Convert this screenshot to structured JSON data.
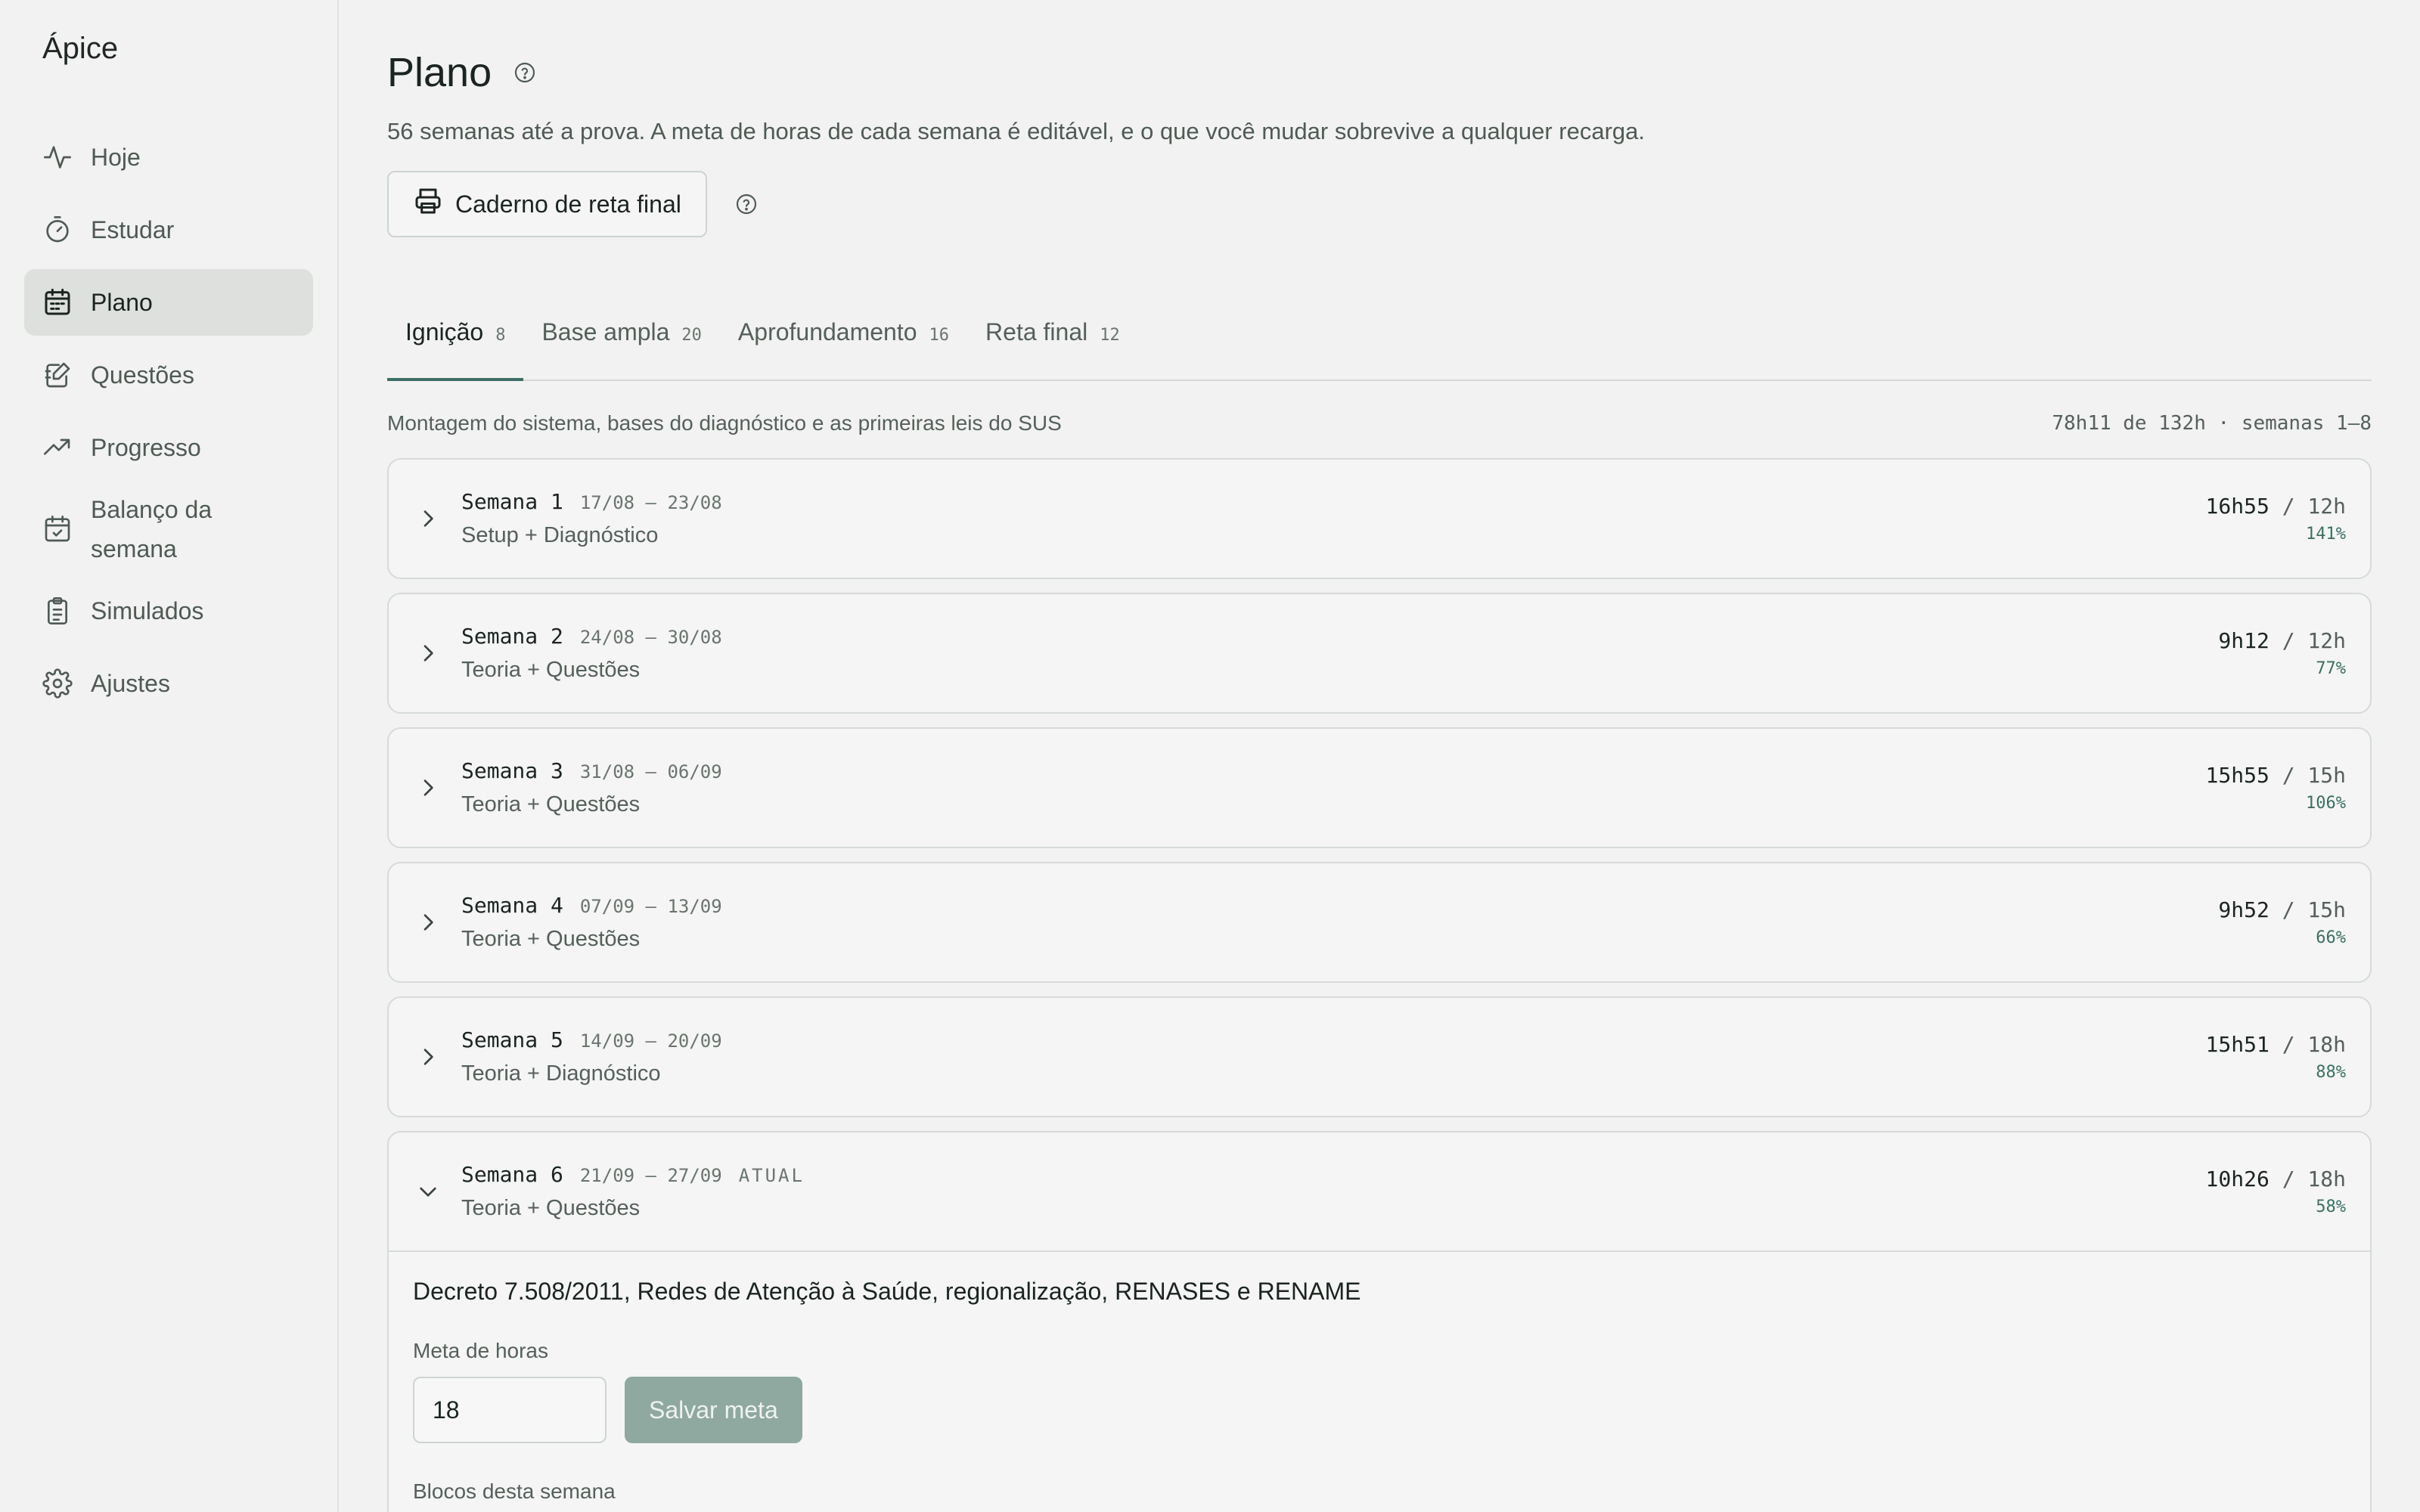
{
  "brand": "Ápice",
  "sidebar": {
    "items": [
      {
        "label": "Hoje",
        "icon": "activity-icon"
      },
      {
        "label": "Estudar",
        "icon": "timer-icon"
      },
      {
        "label": "Plano",
        "icon": "calendar-icon",
        "active": true
      },
      {
        "label": "Questões",
        "icon": "edit-notebook-icon"
      },
      {
        "label": "Progresso",
        "icon": "trending-up-icon"
      },
      {
        "label": "Balanço da semana",
        "icon": "calendar-check-icon"
      },
      {
        "label": "Simulados",
        "icon": "clipboard-icon"
      },
      {
        "label": "Ajustes",
        "icon": "gear-icon"
      }
    ]
  },
  "header": {
    "title": "Plano",
    "subtitle": "56 semanas até a prova. A meta de horas de cada semana é editável, e o que você mudar sobrevive a qualquer recarga.",
    "print_button": "Caderno de reta final"
  },
  "tabs": [
    {
      "label": "Ignição",
      "count": "8"
    },
    {
      "label": "Base ampla",
      "count": "20"
    },
    {
      "label": "Aprofundamento",
      "count": "16"
    },
    {
      "label": "Reta final",
      "count": "12"
    }
  ],
  "phase": {
    "description": "Montagem do sistema, bases do diagnóstico e as primeiras leis do SUS",
    "summary": "78h11 de 132h · semanas 1–8"
  },
  "weeks": [
    {
      "label": "Semana 1",
      "dates": "17/08 – 23/08",
      "tag": "",
      "sub": "Setup + Diagnóstico",
      "done": "16h55",
      "sep": "/",
      "goal": "12h",
      "pct": "141%"
    },
    {
      "label": "Semana 2",
      "dates": "24/08 – 30/08",
      "tag": "",
      "sub": "Teoria + Questões",
      "done": "9h12",
      "sep": "/",
      "goal": "12h",
      "pct": "77%"
    },
    {
      "label": "Semana 3",
      "dates": "31/08 – 06/09",
      "tag": "",
      "sub": "Teoria + Questões",
      "done": "15h55",
      "sep": "/",
      "goal": "15h",
      "pct": "106%"
    },
    {
      "label": "Semana 4",
      "dates": "07/09 – 13/09",
      "tag": "",
      "sub": "Teoria + Questões",
      "done": "9h52",
      "sep": "/",
      "goal": "15h",
      "pct": "66%"
    },
    {
      "label": "Semana 5",
      "dates": "14/09 – 20/09",
      "tag": "",
      "sub": "Teoria + Diagnóstico",
      "done": "15h51",
      "sep": "/",
      "goal": "18h",
      "pct": "88%"
    },
    {
      "label": "Semana 6",
      "dates": "21/09 – 27/09",
      "tag": "ATUAL",
      "sub": "Teoria + Questões",
      "done": "10h26",
      "sep": "/",
      "goal": "18h",
      "pct": "58%"
    }
  ],
  "open_week": {
    "topic": "Decreto 7.508/2011, Redes de Atenção à Saúde, regionalização, RENASES e RENAME",
    "goal_label": "Meta de horas",
    "goal_value": "18",
    "save_label": "Salvar meta",
    "blocks_label": "Blocos desta semana"
  },
  "colors": {
    "accent": "#3d6f62",
    "save_button": "#8fa8a0",
    "background": "#f1f2f1"
  }
}
